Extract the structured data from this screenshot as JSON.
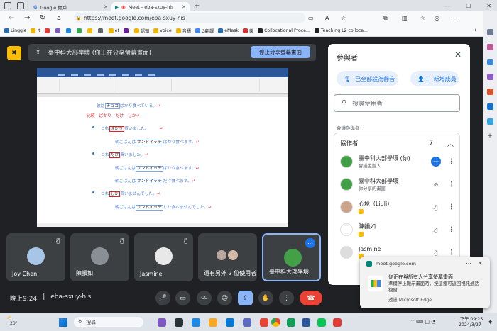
{
  "browser": {
    "tabs": [
      {
        "label": "Google 帳戶",
        "active": false
      },
      {
        "label": "Meet - eba-sxuy-his",
        "active": true
      }
    ],
    "url": "https://meet.google.com/eba-sxuy-his",
    "bookmarks": [
      {
        "label": "Linggle",
        "color": "#2b6cb0"
      },
      {
        "label": "jt",
        "color": "#f4b400"
      },
      {
        "label": "",
        "color": "#e53935"
      },
      {
        "label": "",
        "color": "#7e57c2"
      },
      {
        "label": "",
        "color": "#1e88e5"
      },
      {
        "label": "",
        "color": "#34a853"
      },
      {
        "label": "",
        "color": "#fbbc04"
      },
      {
        "label": "",
        "color": "#5f6368"
      },
      {
        "label": "et",
        "color": "#f4b400"
      },
      {
        "label": "",
        "color": "#6a1b9a"
      },
      {
        "label": "認知",
        "color": "#f4b400"
      },
      {
        "label": "voice",
        "color": "#f4b400"
      },
      {
        "label": "音標",
        "color": "#f4b400"
      },
      {
        "label": "G翻譯",
        "color": "#4285f4"
      },
      {
        "label": "eMask",
        "color": "#2b6cb0"
      },
      {
        "label": "樂",
        "color": "#d32f2f"
      },
      {
        "label": "Collocational Proce...",
        "color": "#222222"
      },
      {
        "label": "Teaching L2 colloca...",
        "color": "#222222"
      }
    ]
  },
  "share_bar": {
    "text": "臺中科大部學壞 (你正在分享螢幕畫面)",
    "stop_label": "停止分享螢幕畫面"
  },
  "doc": {
    "lines": [
      {
        "parts": [
          {
            "t": "彼は",
            "c": "b"
          },
          {
            "t": "チョコ",
            "c": "boxb"
          },
          {
            "t": "ばかり",
            "c": "b"
          },
          {
            "t": "食べている。",
            "c": "b"
          },
          {
            "t": "↵",
            "c": "r"
          }
        ]
      },
      {
        "parts": [
          {
            "t": "比較　ばかり　だけ　しか",
            "c": "r"
          },
          {
            "t": "↵",
            "c": "r"
          }
        ]
      },
      {
        "parts": [
          {
            "t": "これ",
            "c": "b"
          },
          {
            "t": "ばかり",
            "c": "box"
          },
          {
            "t": "買いました。",
            "c": "b"
          },
          {
            "t": "　　　↵",
            "c": "r"
          }
        ]
      },
      {
        "parts": [
          {
            "t": "朝ごはんは",
            "c": "b"
          },
          {
            "t": "サンドイッチ",
            "c": "boxb"
          },
          {
            "t": "ばかり食べます。",
            "c": "b"
          },
          {
            "t": "↵",
            "c": "r"
          }
        ]
      },
      {
        "parts": [
          {
            "t": "これ",
            "c": "b"
          },
          {
            "t": "だけ",
            "c": "box"
          },
          {
            "t": "買いました。",
            "c": "b"
          },
          {
            "t": "↵",
            "c": "r"
          }
        ]
      },
      {
        "parts": [
          {
            "t": "朝ごはんは",
            "c": "b"
          },
          {
            "t": "サンドイッチ",
            "c": "boxb"
          },
          {
            "t": "ばかり食べます。",
            "c": "b"
          },
          {
            "t": "↵",
            "c": "r"
          }
        ]
      },
      {
        "parts": [
          {
            "t": "朝ごはんは",
            "c": "b"
          },
          {
            "t": "サンドイッチ",
            "c": "boxb"
          },
          {
            "t": "だけ食べます。",
            "c": "b"
          },
          {
            "t": "↵",
            "c": "r"
          }
        ]
      },
      {
        "parts": [
          {
            "t": "これ",
            "c": "b"
          },
          {
            "t": "しか",
            "c": "box"
          },
          {
            "t": "買いません",
            "c": "b"
          },
          {
            "t": "でした。",
            "c": "b"
          },
          {
            "t": "↵",
            "c": "r"
          }
        ]
      },
      {
        "parts": [
          {
            "t": "朝ごはんは",
            "c": "b"
          },
          {
            "t": "サンドイッチ",
            "c": "boxb"
          },
          {
            "t": "しか食べませんでした。",
            "c": "b"
          },
          {
            "t": "↵",
            "c": "r"
          }
        ]
      }
    ]
  },
  "panel": {
    "title": "參與者",
    "mute_all": "已全部設為靜音",
    "add": "新增成員",
    "search_placeholder": "搜尋使用者",
    "section": "會議參與者",
    "group_label": "協作者",
    "group_count": "7",
    "people": [
      {
        "name": "臺中科大部學壞 (你)",
        "sub": "會議主辦人",
        "avatar": "#43a047",
        "icon": "more",
        "badge": ""
      },
      {
        "name": "臺中科大部學壞",
        "sub": "你分享的畫面",
        "avatar": "#43a047",
        "icon": "present-off",
        "badge": ""
      },
      {
        "name": "心境（Liuli）",
        "sub": "",
        "avatar": "#c9a48a",
        "icon": "mic-off",
        "badge": "#fbbc04"
      },
      {
        "name": "陳韻如",
        "sub": "",
        "avatar": "#ffffff",
        "icon": "mic-off",
        "badge": "#fbbc04"
      },
      {
        "name": "Jasmine",
        "sub": "",
        "avatar": "#dddddd",
        "icon": "mic-off",
        "badge": "#fbbc04"
      }
    ]
  },
  "tiles": [
    {
      "name": "Joy Chen",
      "avatar": "#a7c5e6"
    },
    {
      "name": "陳韻如",
      "avatar": "#8a8f96"
    },
    {
      "name": "Jasmine",
      "avatar": "#e8e8e8"
    },
    {
      "name": "還有另外 2 位使用者",
      "avatar": "#b9a8a0"
    },
    {
      "name": "臺中科大部學壞",
      "avatar": "#43a047"
    }
  ],
  "meeting": {
    "time": "晚上9:24",
    "code": "eba-sxuy-his"
  },
  "toast": {
    "source": "meet.google.com",
    "title": "你正在與所有人分享螢幕畫面",
    "body": "準備停止顯示畫面時，按這裡可返回視訊通話視窗",
    "app": "透過 Microsoft Edge"
  },
  "taskbar": {
    "weather": "20°",
    "search": "搜尋",
    "time": "下午 09:25",
    "date": "2024/3/27"
  },
  "colors": {
    "meet_bg": "#202124",
    "tile_bg": "#3c4043",
    "accent": "#8ab4f8",
    "end_call": "#ea4335",
    "present_active": "#8ab4f8"
  }
}
